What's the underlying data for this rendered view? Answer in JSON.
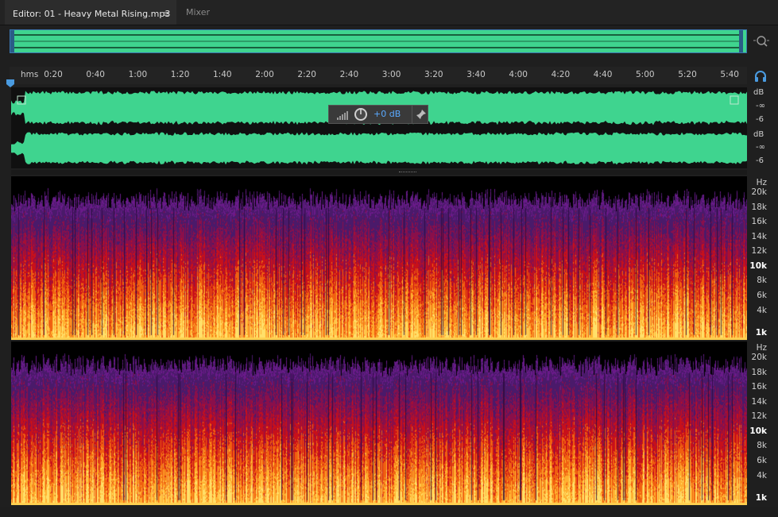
{
  "tabs": {
    "editor_label": "Editor: 01 - Heavy Metal Rising.mp3",
    "menu_glyph": "≡",
    "mixer_label": "Mixer"
  },
  "icons": {
    "zoom": "zoom-icon",
    "headphones": "headphones-icon",
    "playhead": "playhead-icon",
    "pin": "pin-icon",
    "knob": "volume-knob-icon",
    "meter": "level-meter-icon"
  },
  "colors": {
    "waveform": "#3fd48f",
    "accent": "#5aa9ff",
    "selection_border": "#3a76b0",
    "background": "#1f1f1f"
  },
  "ruler": {
    "unit": "hms",
    "ticks": [
      "0:20",
      "0:40",
      "1:00",
      "1:20",
      "1:40",
      "2:00",
      "2:20",
      "2:40",
      "3:00",
      "3:20",
      "3:40",
      "4:00",
      "4:20",
      "4:40",
      "5:00",
      "5:20",
      "5:40"
    ]
  },
  "channel1": {
    "unit": "dB",
    "top_value": "-∞",
    "bottom_value": "-6"
  },
  "channel2": {
    "unit": "dB",
    "top_value": "-∞",
    "bottom_value": "-6"
  },
  "hud": {
    "gain": "+0 dB"
  },
  "spectral": {
    "unit": "Hz",
    "labels": [
      "20k",
      "18k",
      "16k",
      "14k",
      "12k",
      "10k",
      "8k",
      "6k",
      "4k",
      "1k"
    ]
  }
}
